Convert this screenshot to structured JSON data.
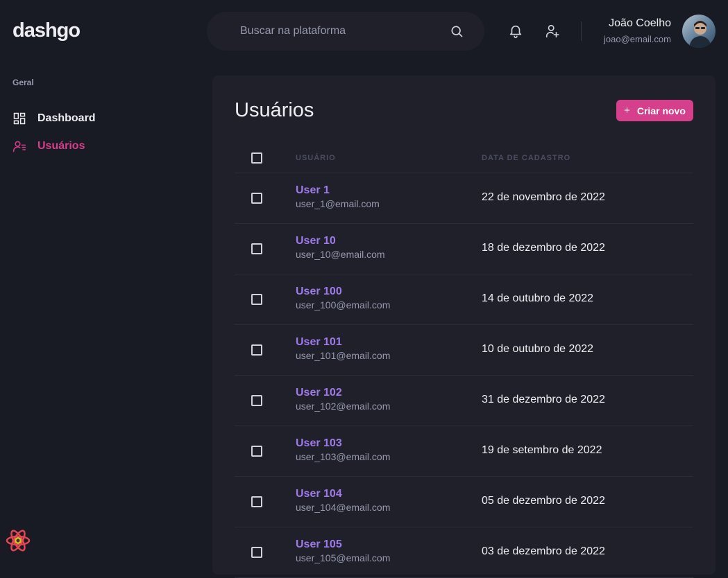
{
  "app": {
    "logo": "dashgo"
  },
  "search": {
    "placeholder": "Buscar na plataforma"
  },
  "profile": {
    "name": "João Coelho",
    "email": "joao@email.com"
  },
  "sidebar": {
    "section_title": "Geral",
    "items": [
      {
        "label": "Dashboard",
        "icon": "dashboard-icon",
        "active": false
      },
      {
        "label": "Usuários",
        "icon": "users-icon",
        "active": true
      }
    ]
  },
  "main": {
    "title": "Usuários",
    "create_button": "Criar novo",
    "table": {
      "headers": [
        "USUÁRIO",
        "DATA DE CADASTRO"
      ],
      "rows": [
        {
          "name": "User 1",
          "email": "user_1@email.com",
          "date": "22 de novembro de 2022"
        },
        {
          "name": "User 10",
          "email": "user_10@email.com",
          "date": "18 de dezembro de 2022"
        },
        {
          "name": "User 100",
          "email": "user_100@email.com",
          "date": "14 de outubro de 2022"
        },
        {
          "name": "User 101",
          "email": "user_101@email.com",
          "date": "10 de outubro de 2022"
        },
        {
          "name": "User 102",
          "email": "user_102@email.com",
          "date": "31 de dezembro de 2022"
        },
        {
          "name": "User 103",
          "email": "user_103@email.com",
          "date": "19 de setembro de 2022"
        },
        {
          "name": "User 104",
          "email": "user_104@email.com",
          "date": "05 de dezembro de 2022"
        },
        {
          "name": "User 105",
          "email": "user_105@email.com",
          "date": "03 de dezembro de 2022"
        }
      ]
    }
  },
  "colors": {
    "accent": "#d53f8c",
    "link": "#9f7aea",
    "background": "#181b23",
    "panel": "#1f2029"
  }
}
